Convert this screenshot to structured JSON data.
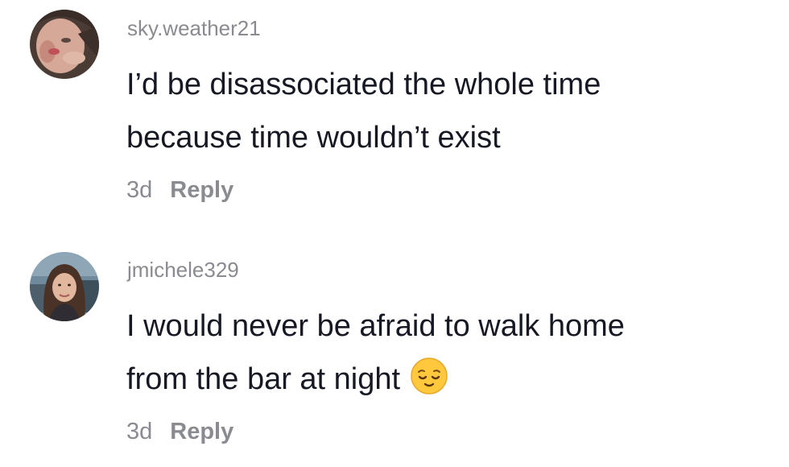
{
  "comments": [
    {
      "username": "sky.weather21",
      "lines": [
        "I’d be disassociated the whole time",
        "because time wouldn’t exist"
      ],
      "date": "3d",
      "reply_label": "Reply",
      "avatar": "user-photo-1"
    },
    {
      "username": "jmichele329",
      "lines": [
        "I would never be afraid to walk home",
        "from the bar at night"
      ],
      "emoji": "relieved-face-icon",
      "date": "3d",
      "reply_label": "Reply",
      "avatar": "user-photo-2"
    }
  ],
  "colors": {
    "username": "#8a8b91",
    "text": "#161823",
    "meta": "#8a8b91"
  }
}
